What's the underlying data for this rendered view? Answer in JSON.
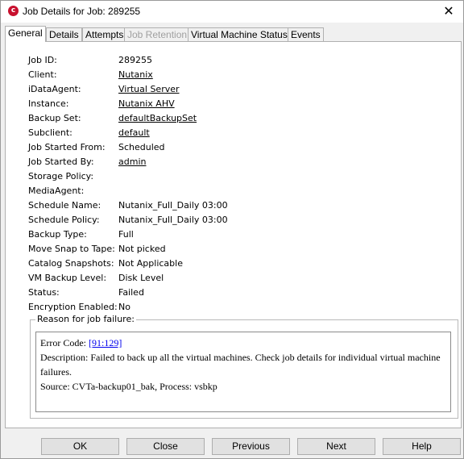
{
  "window": {
    "title": "Job Details for Job: 289255",
    "close_glyph": "✕"
  },
  "tabs": [
    {
      "label": "General",
      "active": true,
      "enabled": true
    },
    {
      "label": "Details",
      "active": false,
      "enabled": true
    },
    {
      "label": "Attempts",
      "active": false,
      "enabled": true
    },
    {
      "label": "Job Retention",
      "active": false,
      "enabled": false
    },
    {
      "label": "Virtual Machine Status",
      "active": false,
      "enabled": true
    },
    {
      "label": "Events",
      "active": false,
      "enabled": true
    }
  ],
  "general": {
    "job_id": {
      "label": "Job ID:",
      "value": "289255"
    },
    "client": {
      "label": "Client:",
      "value": "Nutanix"
    },
    "idataagent": {
      "label": "iDataAgent:",
      "value": "Virtual Server"
    },
    "instance": {
      "label": "Instance:",
      "value": "Nutanix AHV"
    },
    "backup_set": {
      "label": "Backup Set:",
      "value": "defaultBackupSet"
    },
    "subclient": {
      "label": "Subclient:",
      "value": "default"
    },
    "job_started_from": {
      "label": "Job Started From:",
      "value": "Scheduled"
    },
    "job_started_by": {
      "label": "Job Started By:",
      "value": "admin"
    },
    "storage_policy": {
      "label": "Storage Policy:",
      "value": ""
    },
    "media_agent": {
      "label": "MediaAgent:",
      "value": ""
    },
    "schedule_name": {
      "label": "Schedule Name:",
      "value": "Nutanix_Full_Daily 03:00"
    },
    "schedule_policy": {
      "label": "Schedule Policy:",
      "value": "Nutanix_Full_Daily 03:00"
    },
    "backup_type": {
      "label": "Backup Type:",
      "value": "Full"
    },
    "move_snap": {
      "label": "Move Snap to Tape:",
      "value": "Not picked"
    },
    "catalog_snapshots": {
      "label": "Catalog Snapshots:",
      "value": "Not Applicable"
    },
    "vm_backup_level": {
      "label": "VM Backup Level:",
      "value": "Disk Level"
    },
    "status": {
      "label": "Status:",
      "value": "Failed"
    },
    "encryption": {
      "label": "Encryption Enabled:",
      "value": "No"
    }
  },
  "failure": {
    "legend": "Reason for job failure:",
    "error_code_label": "Error Code: ",
    "error_code": "[91:129]",
    "description": "Description: Failed to back up all the virtual machines. Check job details for individual virtual machine failures.",
    "source": "Source: CVTa-backup01_bak, Process: vsbkp"
  },
  "buttons": {
    "ok": "OK",
    "close": "Close",
    "previous": "Previous",
    "next": "Next",
    "help": "Help"
  },
  "colors": {
    "app_icon": "#c8102e",
    "link_blue": "#0000ee"
  }
}
